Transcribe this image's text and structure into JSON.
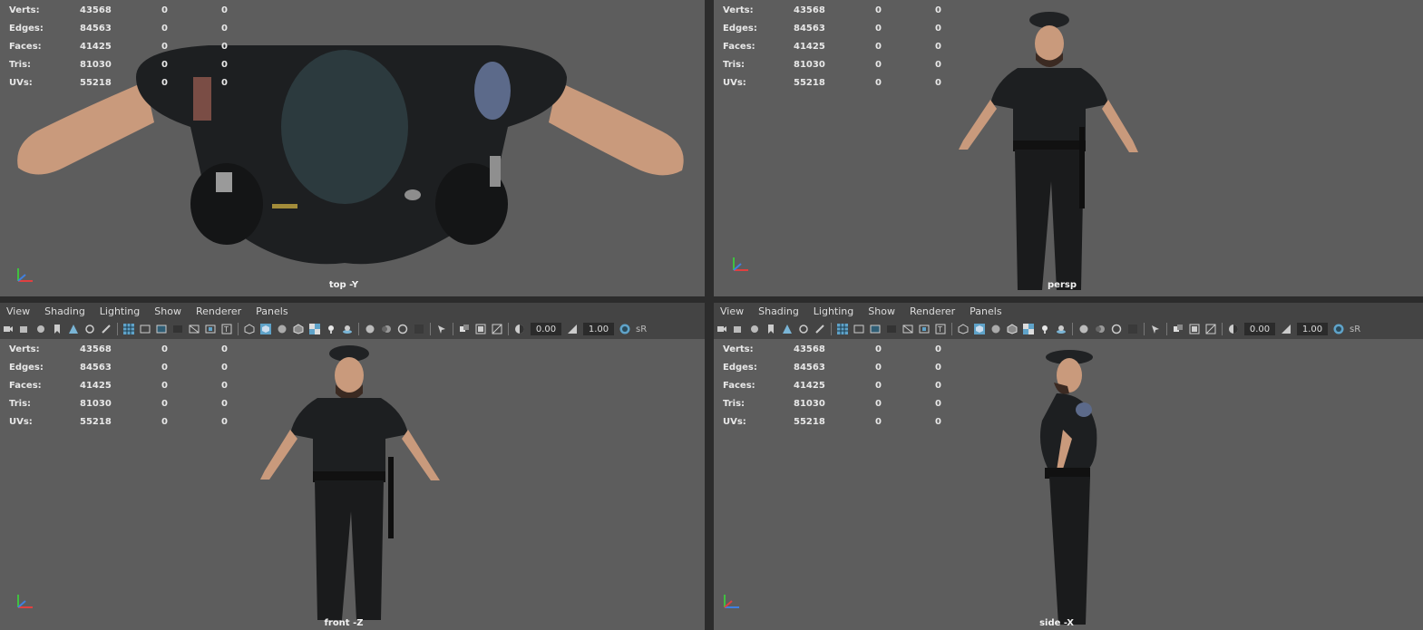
{
  "stats": {
    "rows": [
      {
        "label": "Verts:",
        "value": "43568",
        "a": "0",
        "b": "0"
      },
      {
        "label": "Edges:",
        "value": "84563",
        "a": "0",
        "b": "0"
      },
      {
        "label": "Faces:",
        "value": "41425",
        "a": "0",
        "b": "0"
      },
      {
        "label": "Tris:",
        "value": "81030",
        "a": "0",
        "b": "0"
      },
      {
        "label": "UVs:",
        "value": "55218",
        "a": "0",
        "b": "0"
      }
    ]
  },
  "cameras": {
    "top": "top -Y",
    "persp": "persp",
    "front": "front -Z",
    "side": "side -X"
  },
  "panel_menu": {
    "view": "View",
    "shading": "Shading",
    "lighting": "Lighting",
    "show": "Show",
    "renderer": "Renderer",
    "panels": "Panels"
  },
  "toolbar": {
    "exposure": "0.00",
    "gamma": "1.00",
    "color_space": "sR"
  },
  "colors": {
    "viewport_bg": "#5d5d5d",
    "panel_bg": "#444444",
    "highlight": "#5fa3c9",
    "uniform": "#1b1f22",
    "skin": "#c99a7c"
  },
  "icons": [
    "camera-icon",
    "film-gate-icon",
    "grid-icon",
    "wireframe-icon",
    "smooth-shade-icon",
    "texture-icon",
    "light-icon",
    "shadow-icon",
    "isolate-icon",
    "xray-icon",
    "exposure-icon",
    "gamma-icon"
  ]
}
